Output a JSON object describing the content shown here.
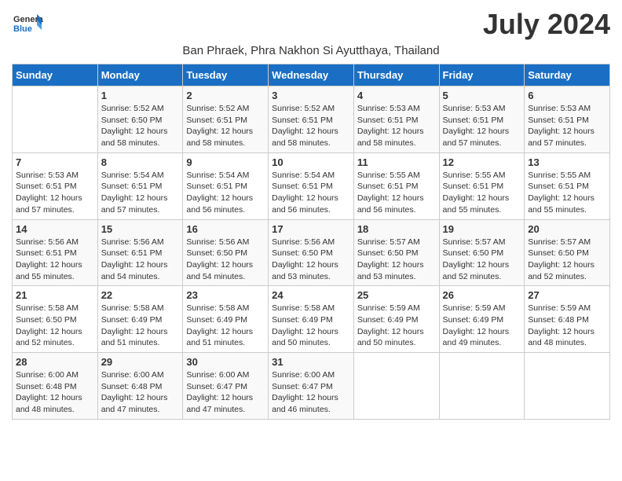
{
  "header": {
    "logo_general": "General",
    "logo_blue": "Blue",
    "month_title": "July 2024",
    "subtitle": "Ban Phraek, Phra Nakhon Si Ayutthaya, Thailand"
  },
  "days_of_week": [
    "Sunday",
    "Monday",
    "Tuesday",
    "Wednesday",
    "Thursday",
    "Friday",
    "Saturday"
  ],
  "weeks": [
    [
      {
        "day": "",
        "detail": ""
      },
      {
        "day": "1",
        "detail": "Sunrise: 5:52 AM\nSunset: 6:50 PM\nDaylight: 12 hours\nand 58 minutes."
      },
      {
        "day": "2",
        "detail": "Sunrise: 5:52 AM\nSunset: 6:51 PM\nDaylight: 12 hours\nand 58 minutes."
      },
      {
        "day": "3",
        "detail": "Sunrise: 5:52 AM\nSunset: 6:51 PM\nDaylight: 12 hours\nand 58 minutes."
      },
      {
        "day": "4",
        "detail": "Sunrise: 5:53 AM\nSunset: 6:51 PM\nDaylight: 12 hours\nand 58 minutes."
      },
      {
        "day": "5",
        "detail": "Sunrise: 5:53 AM\nSunset: 6:51 PM\nDaylight: 12 hours\nand 57 minutes."
      },
      {
        "day": "6",
        "detail": "Sunrise: 5:53 AM\nSunset: 6:51 PM\nDaylight: 12 hours\nand 57 minutes."
      }
    ],
    [
      {
        "day": "7",
        "detail": "Sunrise: 5:53 AM\nSunset: 6:51 PM\nDaylight: 12 hours\nand 57 minutes."
      },
      {
        "day": "8",
        "detail": "Sunrise: 5:54 AM\nSunset: 6:51 PM\nDaylight: 12 hours\nand 57 minutes."
      },
      {
        "day": "9",
        "detail": "Sunrise: 5:54 AM\nSunset: 6:51 PM\nDaylight: 12 hours\nand 56 minutes."
      },
      {
        "day": "10",
        "detail": "Sunrise: 5:54 AM\nSunset: 6:51 PM\nDaylight: 12 hours\nand 56 minutes."
      },
      {
        "day": "11",
        "detail": "Sunrise: 5:55 AM\nSunset: 6:51 PM\nDaylight: 12 hours\nand 56 minutes."
      },
      {
        "day": "12",
        "detail": "Sunrise: 5:55 AM\nSunset: 6:51 PM\nDaylight: 12 hours\nand 55 minutes."
      },
      {
        "day": "13",
        "detail": "Sunrise: 5:55 AM\nSunset: 6:51 PM\nDaylight: 12 hours\nand 55 minutes."
      }
    ],
    [
      {
        "day": "14",
        "detail": "Sunrise: 5:56 AM\nSunset: 6:51 PM\nDaylight: 12 hours\nand 55 minutes."
      },
      {
        "day": "15",
        "detail": "Sunrise: 5:56 AM\nSunset: 6:51 PM\nDaylight: 12 hours\nand 54 minutes."
      },
      {
        "day": "16",
        "detail": "Sunrise: 5:56 AM\nSunset: 6:50 PM\nDaylight: 12 hours\nand 54 minutes."
      },
      {
        "day": "17",
        "detail": "Sunrise: 5:56 AM\nSunset: 6:50 PM\nDaylight: 12 hours\nand 53 minutes."
      },
      {
        "day": "18",
        "detail": "Sunrise: 5:57 AM\nSunset: 6:50 PM\nDaylight: 12 hours\nand 53 minutes."
      },
      {
        "day": "19",
        "detail": "Sunrise: 5:57 AM\nSunset: 6:50 PM\nDaylight: 12 hours\nand 52 minutes."
      },
      {
        "day": "20",
        "detail": "Sunrise: 5:57 AM\nSunset: 6:50 PM\nDaylight: 12 hours\nand 52 minutes."
      }
    ],
    [
      {
        "day": "21",
        "detail": "Sunrise: 5:58 AM\nSunset: 6:50 PM\nDaylight: 12 hours\nand 52 minutes."
      },
      {
        "day": "22",
        "detail": "Sunrise: 5:58 AM\nSunset: 6:49 PM\nDaylight: 12 hours\nand 51 minutes."
      },
      {
        "day": "23",
        "detail": "Sunrise: 5:58 AM\nSunset: 6:49 PM\nDaylight: 12 hours\nand 51 minutes."
      },
      {
        "day": "24",
        "detail": "Sunrise: 5:58 AM\nSunset: 6:49 PM\nDaylight: 12 hours\nand 50 minutes."
      },
      {
        "day": "25",
        "detail": "Sunrise: 5:59 AM\nSunset: 6:49 PM\nDaylight: 12 hours\nand 50 minutes."
      },
      {
        "day": "26",
        "detail": "Sunrise: 5:59 AM\nSunset: 6:49 PM\nDaylight: 12 hours\nand 49 minutes."
      },
      {
        "day": "27",
        "detail": "Sunrise: 5:59 AM\nSunset: 6:48 PM\nDaylight: 12 hours\nand 48 minutes."
      }
    ],
    [
      {
        "day": "28",
        "detail": "Sunrise: 6:00 AM\nSunset: 6:48 PM\nDaylight: 12 hours\nand 48 minutes."
      },
      {
        "day": "29",
        "detail": "Sunrise: 6:00 AM\nSunset: 6:48 PM\nDaylight: 12 hours\nand 47 minutes."
      },
      {
        "day": "30",
        "detail": "Sunrise: 6:00 AM\nSunset: 6:47 PM\nDaylight: 12 hours\nand 47 minutes."
      },
      {
        "day": "31",
        "detail": "Sunrise: 6:00 AM\nSunset: 6:47 PM\nDaylight: 12 hours\nand 46 minutes."
      },
      {
        "day": "",
        "detail": ""
      },
      {
        "day": "",
        "detail": ""
      },
      {
        "day": "",
        "detail": ""
      }
    ]
  ]
}
